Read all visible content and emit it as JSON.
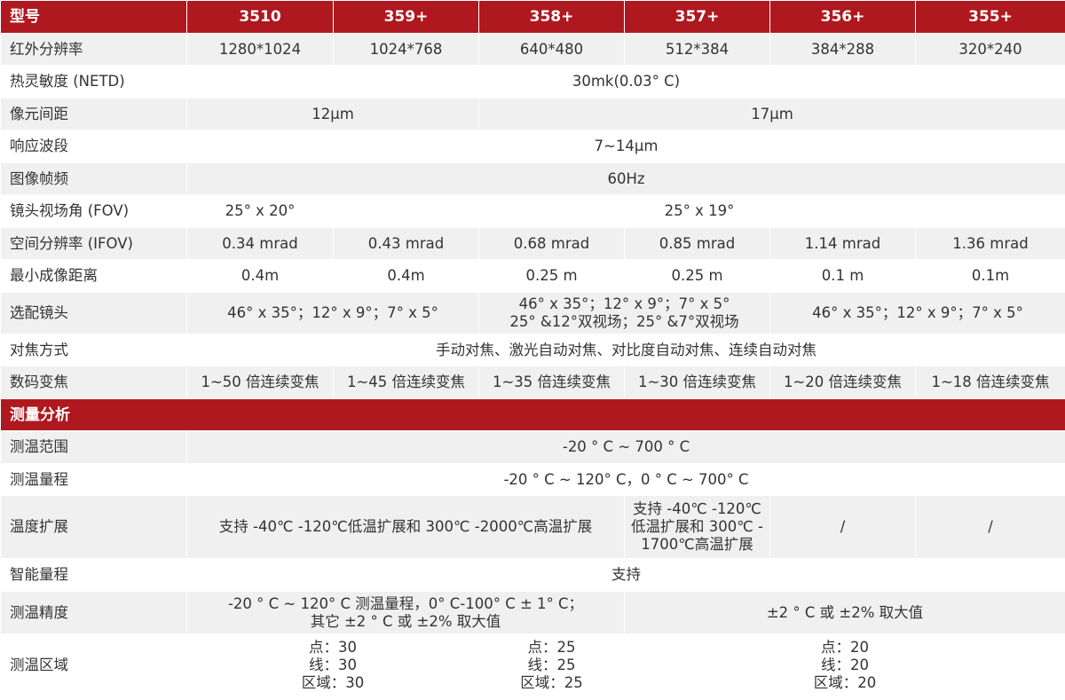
{
  "header": {
    "label": "型号",
    "models": [
      "3510",
      "359+",
      "358+",
      "357+",
      "356+",
      "355+"
    ]
  },
  "rows": {
    "ir_resolution": {
      "label": "红外分辨率",
      "values": [
        "1280*1024",
        "1024*768",
        "640*480",
        "512*384",
        "384*288",
        "320*240"
      ]
    },
    "netd": {
      "label": "热灵敏度 (NETD)",
      "value": "30mk(0.03° C)"
    },
    "pixel_pitch": {
      "label": "像元间距",
      "values": [
        "12μm",
        "17μm"
      ]
    },
    "band": {
      "label": "响应波段",
      "value": "7~14μm"
    },
    "frame_rate": {
      "label": "图像帧频",
      "value": "60Hz"
    },
    "fov": {
      "label": "镜头视场角 (FOV)",
      "values": [
        "25° x 20°",
        "25° x 19°"
      ]
    },
    "ifov": {
      "label": "空间分辨率 (IFOV)",
      "values": [
        "0.34 mrad",
        "0.43 mrad",
        "0.68 mrad",
        "0.85 mrad",
        "1.14 mrad",
        "1.36 mrad"
      ]
    },
    "min_distance": {
      "label": "最小成像距离",
      "values": [
        "0.4m",
        "0.4m",
        "0.25 m",
        "0.25 m",
        "0.1 m",
        "0.1m"
      ]
    },
    "optional_lens": {
      "label": "选配镜头",
      "group1": "46° x 35°；12° x 9°；7° x 5°",
      "group2_line1": "46° x 35°；12° x 9°；7° x 5°",
      "group2_line2": "25° &12°双视场；25° &7°双视场",
      "group3": "46° x 35°；12° x 9°；7° x 5°"
    },
    "focus": {
      "label": "对焦方式",
      "value": "手动对焦、激光自动对焦、对比度自动对焦、连续自动对焦"
    },
    "zoom": {
      "label": "数码变焦",
      "values": [
        "1~50 倍连续变焦",
        "1~45 倍连续变焦",
        "1~35 倍连续变焦",
        "1~30 倍连续变焦",
        "1~20 倍连续变焦",
        "1~18 倍连续变焦"
      ]
    }
  },
  "measurement": {
    "section_title": "测量分析",
    "range": {
      "label": "测温范围",
      "value": "-20 ° C ~ 700 ° C"
    },
    "span": {
      "label": "测温量程",
      "value": "-20 ° C ~ 120° C，0 ° C ~ 700° C"
    },
    "extension": {
      "label": "温度扩展",
      "group1": "支持 -40℃ -120℃低温扩展和 300℃ -2000℃高温扩展",
      "group2_line1": "支持 -40℃ -120℃",
      "group2_line2": "低温扩展和 300℃ -",
      "group2_line3": "1700℃高温扩展",
      "col5": "/",
      "col6": "/"
    },
    "smart_range": {
      "label": "智能量程",
      "value": "支持"
    },
    "accuracy": {
      "label": "测温精度",
      "group1_line1": "-20 ° C ~ 120° C 测温量程，0° C-100° C ± 1° C；",
      "group1_line2": "其它 ±2 ° C 或 ±2% 取大值",
      "group2": "±2 ° C 或 ±2% 取大值"
    },
    "areas": {
      "label": "测温区域",
      "group1": [
        "点：30",
        "线：30",
        "区域：30"
      ],
      "group2": [
        "点：25",
        "线：25",
        "区域：25"
      ],
      "group3": [
        "点：20",
        "线：20",
        "区域：20"
      ]
    }
  },
  "colors": {
    "header_bg": "#b0181f",
    "header_text": "#ffffff",
    "row_alt_bg": "#f0f0f0",
    "text": "#333333"
  }
}
